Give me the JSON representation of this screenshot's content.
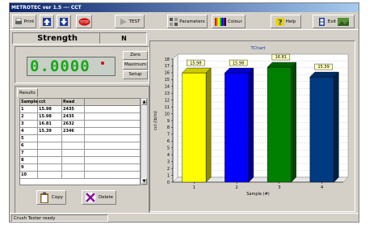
{
  "window": {
    "title": "METROTEC ver 1.5 --- CCT"
  },
  "toolbar": {
    "print_label": "Print",
    "stop_label": "STOP",
    "test_label": "TEST",
    "parameters_label": "Parameters",
    "colour_label": "Colour",
    "help_label": "Help",
    "exit_label": "Exit"
  },
  "strength": {
    "title": "Strength",
    "unit": "N",
    "reading": "0.0000"
  },
  "buttons": {
    "zero": "Zero",
    "maximum": "Maximum",
    "setup": "Setup",
    "copy": "Copy",
    "delete": "Delete"
  },
  "results": {
    "tab_label": "Results",
    "columns": [
      "Sample",
      "cct",
      "Read"
    ],
    "rows": [
      [
        "1",
        "15.98",
        "2435"
      ],
      [
        "2",
        "15.98",
        "2435"
      ],
      [
        "3",
        "16.81",
        "2632"
      ],
      [
        "4",
        "15.39",
        "2346"
      ],
      [
        "5",
        "",
        ""
      ],
      [
        "6",
        "",
        ""
      ],
      [
        "7",
        "",
        ""
      ],
      [
        "8",
        "",
        ""
      ],
      [
        "9",
        "",
        ""
      ],
      [
        "10",
        "",
        ""
      ]
    ]
  },
  "chart_data": {
    "type": "bar",
    "title": "TChart",
    "categories": [
      "1",
      "2",
      "3",
      "4"
    ],
    "values": [
      15.98,
      15.98,
      16.81,
      15.39
    ],
    "data_labels": [
      "15.98",
      "15.98",
      "16.81",
      "15.39"
    ],
    "colors": [
      "#ffff00",
      "#0000ff",
      "#008000",
      "#003a80"
    ],
    "xlabel": "Sample (#)",
    "ylabel": "cct (lb/in)",
    "ylim": [
      0,
      18
    ],
    "y_ticks": [
      "0",
      "1",
      "2",
      "3",
      "4",
      "5",
      "6",
      "7",
      "8",
      "9",
      "10",
      "11",
      "12",
      "13",
      "14",
      "15",
      "16",
      "17",
      "18"
    ],
    "grid": true
  },
  "status": {
    "text": "Crush Tester ready"
  }
}
